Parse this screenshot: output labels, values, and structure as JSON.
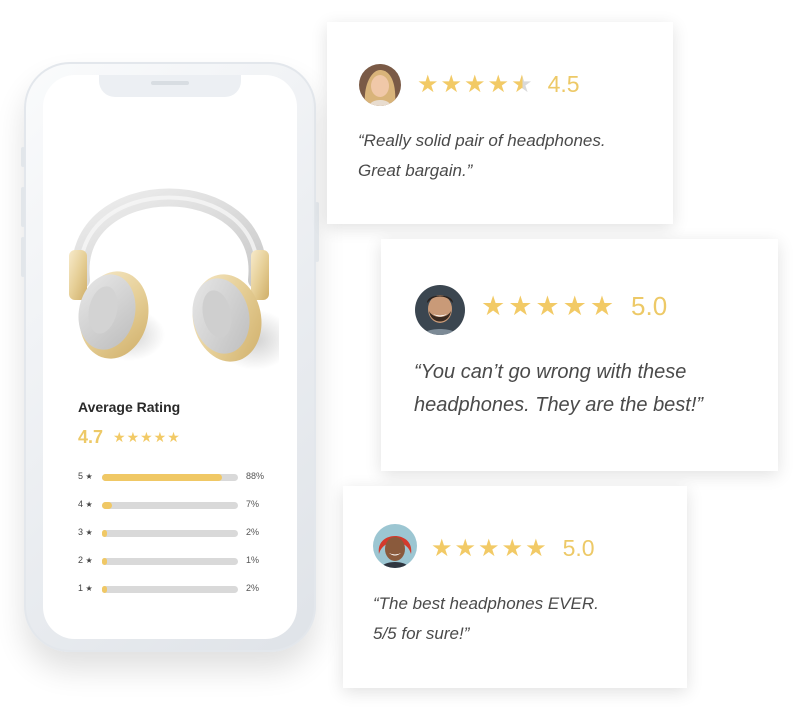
{
  "product": {
    "image_icon": "headphones-image",
    "average_rating_title": "Average Rating",
    "average_rating_value": "4.7",
    "average_stars": "★★★★★",
    "breakdown": [
      {
        "label": "5",
        "star": "★",
        "fraction": 0.88,
        "percent": "88%"
      },
      {
        "label": "4",
        "star": "★",
        "fraction": 0.07,
        "percent": "7%"
      },
      {
        "label": "3",
        "star": "★",
        "fraction": 0.02,
        "percent": "2%"
      },
      {
        "label": "2",
        "star": "★",
        "fraction": 0.01,
        "percent": "1%"
      },
      {
        "label": "1",
        "star": "★",
        "fraction": 0.02,
        "percent": "2%"
      }
    ]
  },
  "reviews": [
    {
      "avatar": "avatar-woman-blonde",
      "stars": "★★★★",
      "half_star": "★",
      "rating": "4.5",
      "quote": "“Really solid pair of headphones.\nGreat bargain.”"
    },
    {
      "avatar": "avatar-man-bearded",
      "stars": "★★★★★",
      "rating": "5.0",
      "quote": "“You can’t go wrong with these\nheadphones. They are the best!”"
    },
    {
      "avatar": "avatar-woman-red-hair",
      "stars": "★★★★★",
      "rating": "5.0",
      "quote": "“The best headphones EVER.\n5/5 for sure!”"
    }
  ],
  "colors": {
    "accent": "#f2ca66",
    "bar_track": "#d9d9d9",
    "text": "#2a2a2a"
  }
}
